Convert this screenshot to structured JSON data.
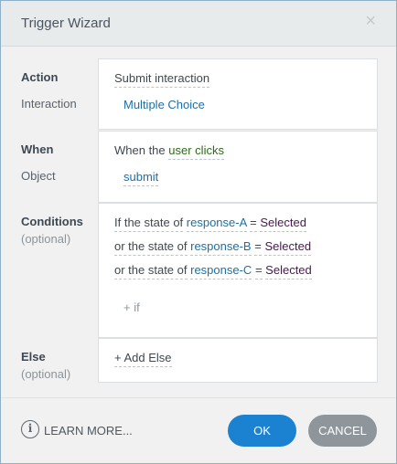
{
  "dialog": {
    "title": "Trigger Wizard",
    "close_glyph": "×"
  },
  "action": {
    "label": "Action",
    "sub_label": "Interaction",
    "value": "Submit interaction",
    "interaction": "Multiple Choice"
  },
  "when": {
    "label": "When",
    "sub_label": "Object",
    "prefix": "When the",
    "event": "user clicks",
    "object": "submit"
  },
  "conditions": {
    "label": "Conditions",
    "sub_label": "(optional)",
    "rows": [
      {
        "connector": "If the state of",
        "target": "response-A",
        "operator": "=",
        "value": "Selected"
      },
      {
        "connector": "or the state of",
        "target": "response-B",
        "operator": "=",
        "value": "Selected"
      },
      {
        "connector": "or the state of",
        "target": "response-C",
        "operator": "=",
        "value": "Selected"
      }
    ],
    "add_if": "+ if"
  },
  "else": {
    "label": "Else",
    "sub_label": "(optional)",
    "add_else": "+ Add Else"
  },
  "footer": {
    "info_glyph": "i",
    "learn_more": "LEARN MORE...",
    "ok": "OK",
    "cancel": "CANCEL"
  },
  "colors": {
    "link": "#1d6fa6",
    "event": "#2f6a1a",
    "value": "#4a1750",
    "ok_button": "#1a82d0",
    "cancel_button": "#8e959b"
  },
  "icons": {
    "close": "close-icon",
    "info": "info-icon"
  }
}
